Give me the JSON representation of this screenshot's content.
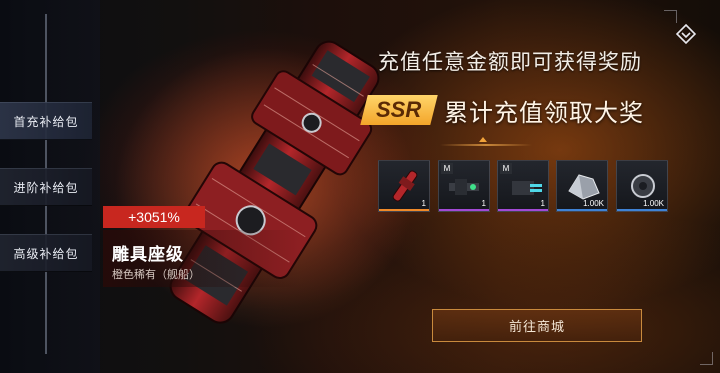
{
  "sidebar": {
    "items": [
      {
        "label": "首充补给包"
      },
      {
        "label": "进阶补给包"
      },
      {
        "label": "高级补给包"
      }
    ]
  },
  "promo": {
    "headline": "充值任意金额即可获得奖励",
    "badge": "SSR",
    "subtitle": "累计充值领取大奖"
  },
  "rewards": [
    {
      "icon": "warship-icon",
      "qty": "1",
      "tag": "",
      "rarity_color": "#f08a2a"
    },
    {
      "icon": "weapon-module-icon",
      "qty": "1",
      "tag": "M",
      "rarity_color": "#a24ad6"
    },
    {
      "icon": "cannon-module-icon",
      "qty": "1",
      "tag": "M",
      "rarity_color": "#a24ad6"
    },
    {
      "icon": "crystal-ore-icon",
      "qty": "1.00K",
      "tag": "",
      "rarity_color": "#3f83d6"
    },
    {
      "icon": "engine-part-icon",
      "qty": "1.00K",
      "tag": "",
      "rarity_color": "#3f83d6"
    }
  ],
  "ship": {
    "bonus": "+3051%",
    "name": "雕具座级",
    "rarity": "橙色稀有（舰船）"
  },
  "cta": {
    "label": "前往商城"
  },
  "colors": {
    "accent": "#f0a23a",
    "ssr_gold": "#ffc24a",
    "bonus_red": "#c8271f"
  }
}
